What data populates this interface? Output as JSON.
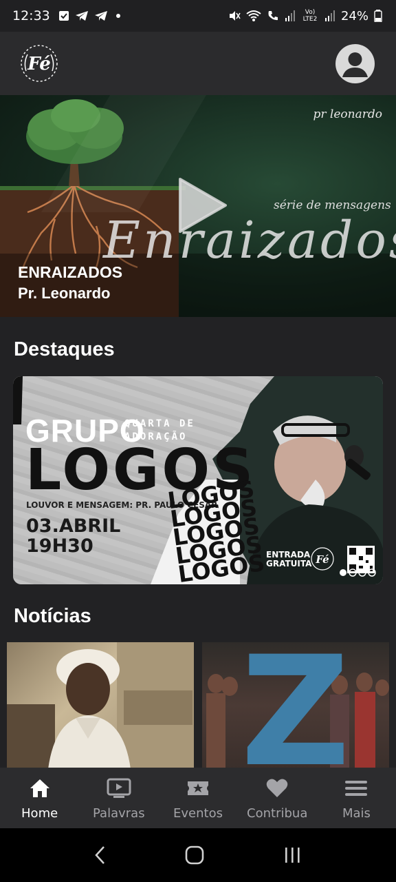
{
  "status_bar": {
    "time": "12:33",
    "battery": "24%",
    "left_icons": [
      "check-box-icon",
      "telegram-icon",
      "telegram-icon",
      "dot-icon"
    ],
    "right_icons": [
      "mute-icon",
      "wifi-icon",
      "call-icon",
      "signal-icon",
      "volte-icon",
      "signal-icon",
      "battery-icon"
    ],
    "volte_label": "Vo) LTE2"
  },
  "header": {
    "logo_text": "Fé",
    "profile_icon": "account-icon"
  },
  "hero": {
    "script_top": "pr leonardo",
    "script_sub": "série de mensagens",
    "script_big": "Enraizados",
    "title": "ENRAIZADOS",
    "subtitle": "Pr. Leonardo",
    "play_icon": "play-icon"
  },
  "highlights": {
    "section_title": "Destaques",
    "card": {
      "grupo": "GRUPO",
      "quarta_line1": "QUARTA DE",
      "quarta_line2": "ADORAÇÃO",
      "logos": "LOGOS",
      "louvor": "LOUVOR E MENSAGEM: PR. PAULO CESAR",
      "date_line1": "03.ABRIL",
      "date_line2": "19H30",
      "logos_stack": [
        "LOGOS",
        "LOGOS",
        "LOGOS",
        "LOGOS",
        "LOGOS"
      ],
      "entrada_line1": "ENTRADA",
      "entrada_line2": "GRATUITA",
      "logo_text": "Fé"
    }
  },
  "news": {
    "section_title": "Notícias"
  },
  "bottom_nav": {
    "items": [
      {
        "label": "Home",
        "icon": "home-icon",
        "active": true
      },
      {
        "label": "Palavras",
        "icon": "video-icon",
        "active": false
      },
      {
        "label": "Eventos",
        "icon": "ticket-icon",
        "active": false
      },
      {
        "label": "Contribua",
        "icon": "heart-icon",
        "active": false
      },
      {
        "label": "Mais",
        "icon": "menu-icon",
        "active": false
      }
    ]
  },
  "colors": {
    "background": "#222224",
    "header": "#2b2b2d",
    "nav_active": "#ffffff",
    "nav_inactive": "#a4a4a8"
  }
}
